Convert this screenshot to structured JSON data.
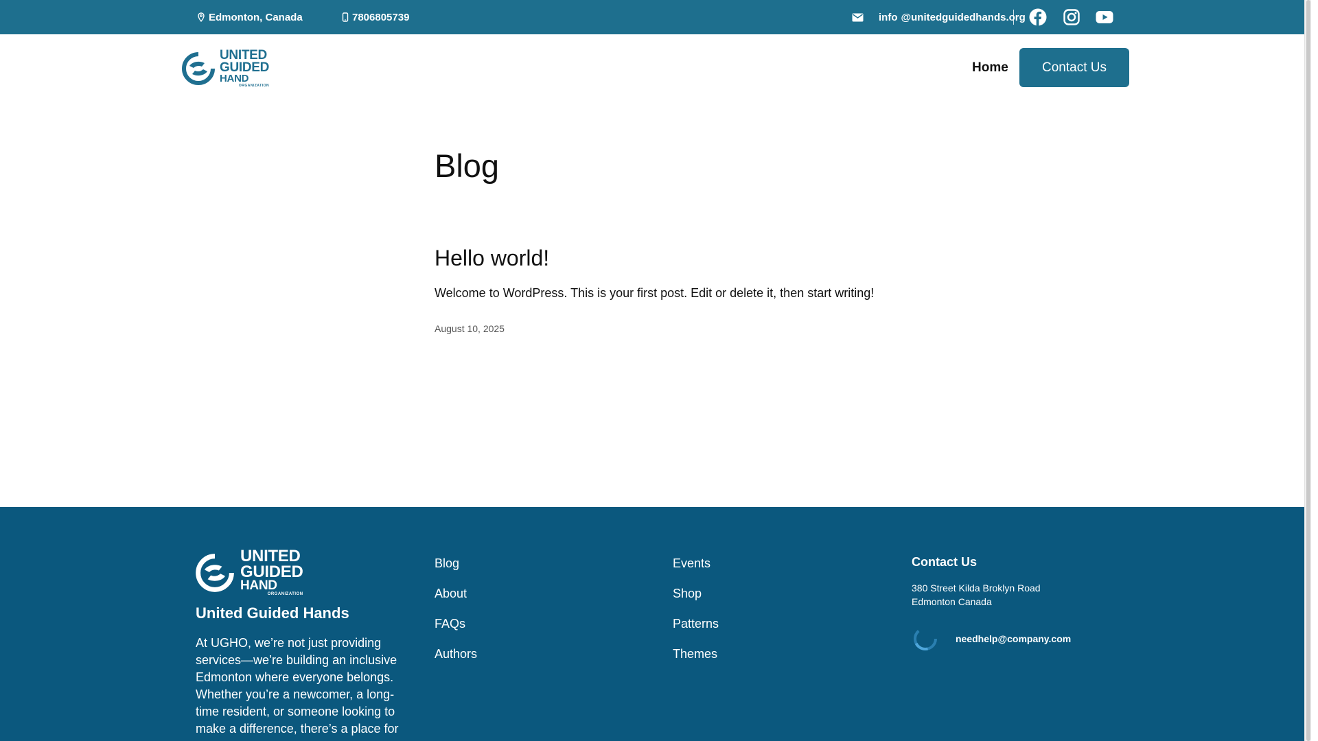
{
  "colors": {
    "primary": "#1e6f8e",
    "footer": "#0b587e",
    "text": "#111111",
    "muted": "#555555"
  },
  "topbar": {
    "location": "Edmonton, Canada",
    "phone": "7806805739",
    "email_user": "info",
    "email_domain": "@unitedguidedhands.org",
    "icons": {
      "location": "map-pin-icon",
      "phone": "phone-icon",
      "email": "envelope-icon",
      "facebook": "facebook-icon",
      "instagram": "instagram-icon",
      "youtube": "youtube-icon"
    }
  },
  "header": {
    "logo": {
      "line1": "UNITED",
      "line2": "GUIDED",
      "line3": "HAND",
      "line4": "ORGANIZATION"
    },
    "nav": {
      "home": "Home"
    },
    "contact_button": "Contact Us"
  },
  "main": {
    "title": "Blog",
    "posts": [
      {
        "title": "Hello world!",
        "excerpt": "Welcome to WordPress. This is your first post. Edit or delete it, then start writing!",
        "date": "August 10, 2025"
      }
    ]
  },
  "footer": {
    "logo": {
      "line1": "UNITED",
      "line2": "GUIDED",
      "line3": "HAND",
      "line4": "ORGANIZATION"
    },
    "org_name": "United Guided Hands",
    "about": "At UGHO, we’re not just providing services—we’re building an inclusive Edmonton where everyone belongs. Whether you’re a newcomer, a long-time resident, or someone looking to make a difference, there’s a place for",
    "links_col1": [
      "Blog",
      "About",
      "FAQs",
      "Authors"
    ],
    "links_col2": [
      "Events",
      "Shop",
      "Patterns",
      "Themes"
    ],
    "contact": {
      "title": "Contact Us",
      "address_line1": "380 Street Kilda Broklyn Road",
      "address_line2": "Edmonton Canada",
      "email": "needhelp@company.com"
    }
  }
}
